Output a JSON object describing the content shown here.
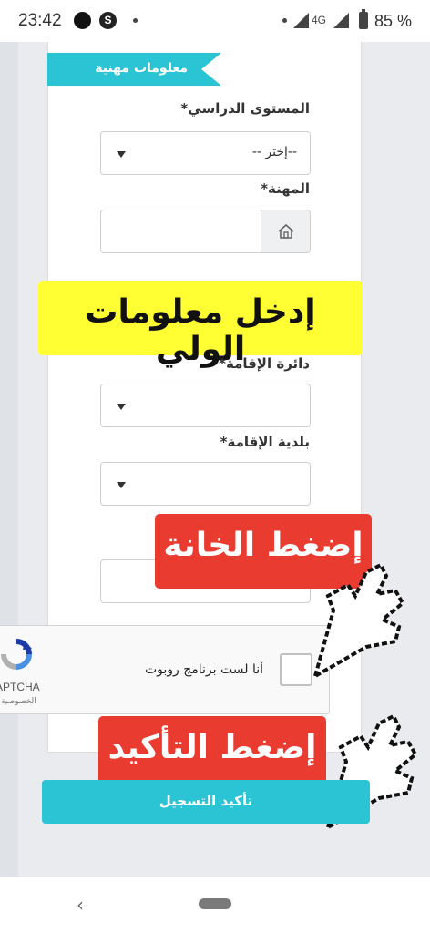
{
  "status_bar": {
    "time": "23:42",
    "network": "4G",
    "battery": "85 %"
  },
  "section": {
    "title": "معلومات مهنية"
  },
  "form": {
    "education_label": "المستوى الدراسي*",
    "education_value": "--إختر --",
    "profession_label": "المهنة*",
    "profession_value": "",
    "residence_district_label": "دائرة الإقامة*",
    "residence_district_value": "",
    "residence_municipality_label": "بلدية الإقامة*",
    "residence_municipality_value": ""
  },
  "overlays": {
    "guardian_banner": "إدخل معلومات الولي",
    "click_box_banner": "إضغط الخانة",
    "click_confirm_banner": "إضغط التأكيد"
  },
  "recaptcha": {
    "label": "أنا لست برنامج روبوت",
    "brand": "APTCHA",
    "privacy": "الخصوصية -"
  },
  "submit": {
    "label": "تأكيد التسجيل"
  },
  "colors": {
    "accent": "#2bc4d4",
    "banner_yellow": "#ffff33",
    "banner_red": "#ea3b30"
  },
  "icons": {
    "profession_addon": "house-icon",
    "recaptcha_logo": "recaptcha-icon",
    "pointer": "hand-pointer-icon",
    "nav_back": "back-chevron-icon"
  }
}
